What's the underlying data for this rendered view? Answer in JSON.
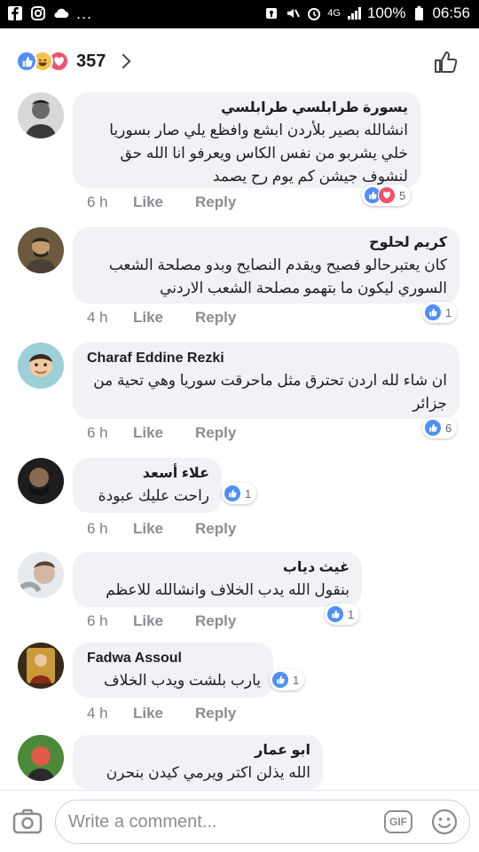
{
  "status_bar": {
    "battery": "100%",
    "time": "06:56",
    "network": "4G",
    "dots": "..."
  },
  "header": {
    "reaction_count": "357",
    "reaction_icons": [
      "like-icon",
      "haha-icon",
      "love-icon"
    ]
  },
  "comments": [
    {
      "name": "يسورة طرابلسي طرابلسي",
      "text": "انشالله بصير بلأردن ابشع وافظع يلي صار بسوريا خلي يشربو من نفس الكاس ويعرفو انا الله حق لنشوف جيشن كم يوم رح يصمد",
      "time": "6 h",
      "like_label": "Like",
      "reply_label": "Reply",
      "reactions": [
        "like",
        "love"
      ],
      "reaction_count": "5"
    },
    {
      "name": "كريم لحلوح",
      "text": "كان يعتبرحالو فصيح ويقدم النصايح وبدو مصلحة الشعب السوري ليكون ما بتهمو مصلحة الشعب الاردني",
      "time": "4 h",
      "like_label": "Like",
      "reply_label": "Reply",
      "reactions": [
        "like"
      ],
      "reaction_count": "1"
    },
    {
      "name": "Charaf Eddine Rezki",
      "text": "ان شاء لله اردن تحترق مثل ماحرقت سوريا وهي تحية من جزائر",
      "time": "6 h",
      "like_label": "Like",
      "reply_label": "Reply",
      "reactions": [
        "like"
      ],
      "reaction_count": "6"
    },
    {
      "name": "علاء أسعد",
      "text": "راحت عليك عبودة",
      "time": "6 h",
      "like_label": "Like",
      "reply_label": "Reply",
      "reactions": [
        "like"
      ],
      "reaction_count": "1"
    },
    {
      "name": "غيث دياب",
      "text": "بنقول الله يدب الخلاف وانشالله للاعظم",
      "time": "6 h",
      "like_label": "Like",
      "reply_label": "Reply",
      "reactions": [
        "like"
      ],
      "reaction_count": "1"
    },
    {
      "name": "Fadwa Assoul",
      "text": "يارب بلشت ويدب الخلاف",
      "time": "4 h",
      "like_label": "Like",
      "reply_label": "Reply",
      "reactions": [
        "like"
      ],
      "reaction_count": "1"
    },
    {
      "name": "ابو عمار",
      "text": "الله يذلن اكتر ويرمي كيدن بنحرن",
      "time": "",
      "like_label": "",
      "reply_label": "",
      "reactions": [],
      "reaction_count": ""
    }
  ],
  "composer": {
    "placeholder": "Write a comment...",
    "gif_label": "GIF"
  },
  "colors": {
    "like_blue": "#4f8ff7",
    "love_red": "#f0506e",
    "haha_yellow": "#f7c24c",
    "bubble_bg": "#f0f2f5"
  }
}
